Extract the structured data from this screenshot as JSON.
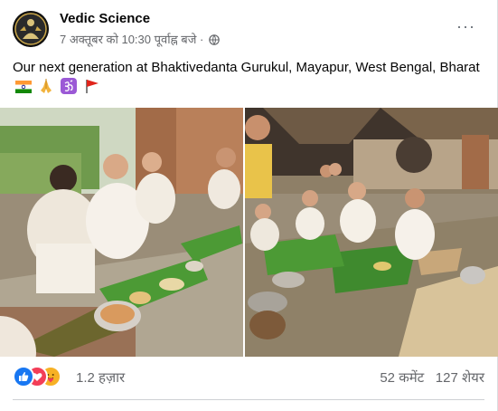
{
  "post": {
    "page_name": "Vedic Science",
    "timestamp": "7 अक्तूबर को 10:30 पूर्वाह्न बजे",
    "separator": "·",
    "audience_icon": "globe-icon",
    "more_label": "···",
    "text_line": "Our next generation at Bhaktivedanta Gurukul, Mayapur, West Bengal, Bharat",
    "text_emojis": [
      "indian-flag-emoji",
      "folded-hands-emoji",
      "om-emoji",
      "red-flag-emoji"
    ]
  },
  "photos": {
    "left_alt": "Children eating on banana leaves",
    "right_alt": "Children seated in rows eating on banana leaves"
  },
  "reactions": {
    "icons": [
      "like-icon",
      "love-icon",
      "care-icon"
    ],
    "count": "1.2 हज़ार",
    "comments": "52 कमेंट",
    "shares": "127 शेयर"
  },
  "colors": {
    "like": "#1877f2",
    "love": "#f33e58",
    "care": "#f7b125",
    "text_secondary": "#65676b"
  }
}
